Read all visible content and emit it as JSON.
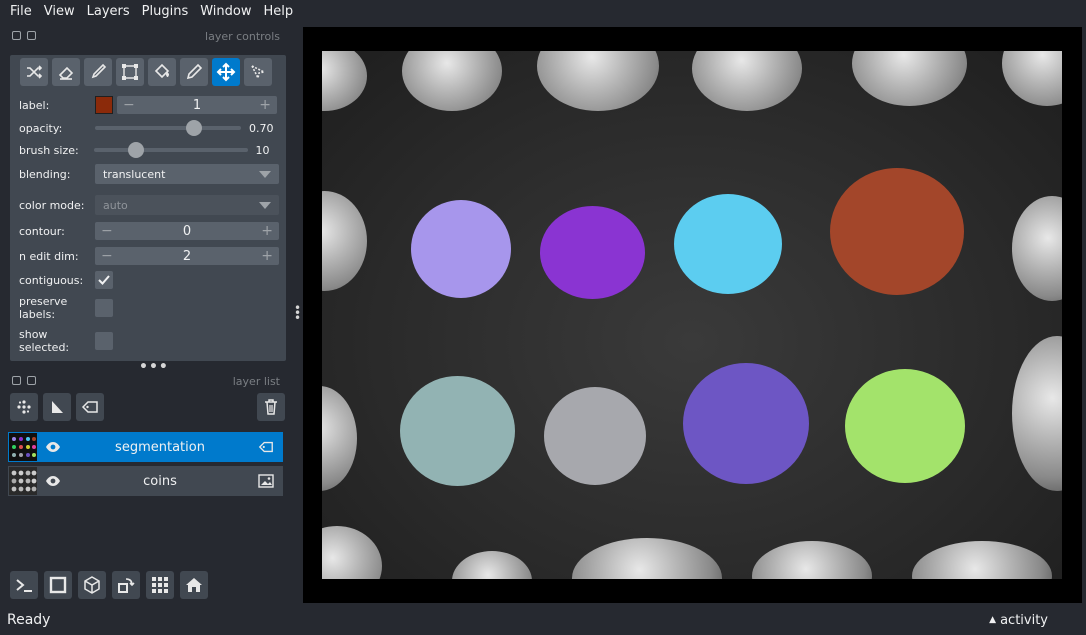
{
  "menubar": {
    "items": [
      "File",
      "View",
      "Layers",
      "Plugins",
      "Window",
      "Help"
    ]
  },
  "layer_controls": {
    "title": "layer controls",
    "tools": [
      "shuffle-icon",
      "eraser-icon",
      "paint-brush-icon",
      "polygon-icon",
      "fill-bucket-icon",
      "color-picker-icon",
      "pan-zoom-icon",
      "transform-icon"
    ],
    "active_tool": "pan-zoom-icon",
    "label": {
      "name": "label:",
      "value": "1",
      "color": "#8b2a0a"
    },
    "opacity": {
      "name": "opacity:",
      "value": "0.70",
      "fraction": 0.7
    },
    "brush_size": {
      "name": "brush size:",
      "value": "10",
      "fraction": 0.25
    },
    "blending": {
      "name": "blending:",
      "value": "translucent"
    },
    "color_mode": {
      "name": "color mode:",
      "value": "auto"
    },
    "contour": {
      "name": "contour:",
      "value": "0"
    },
    "n_edit_dim": {
      "name": "n edit dim:",
      "value": "2"
    },
    "contiguous": {
      "name": "contiguous:",
      "checked": true
    },
    "preserve_labels": {
      "name": "preserve labels:",
      "checked": false
    },
    "show_selected": {
      "name": "show selected:",
      "checked": false
    }
  },
  "layer_list": {
    "title": "layer list",
    "layers": [
      {
        "name": "segmentation",
        "selected": true,
        "type_icon": "label-tag-icon"
      },
      {
        "name": "coins",
        "selected": false,
        "type_icon": "image-icon"
      }
    ]
  },
  "status": {
    "text": "Ready",
    "activity": "activity"
  },
  "colors": {
    "accent": "#007acc",
    "background": "#262930",
    "panel": "#414851"
  }
}
